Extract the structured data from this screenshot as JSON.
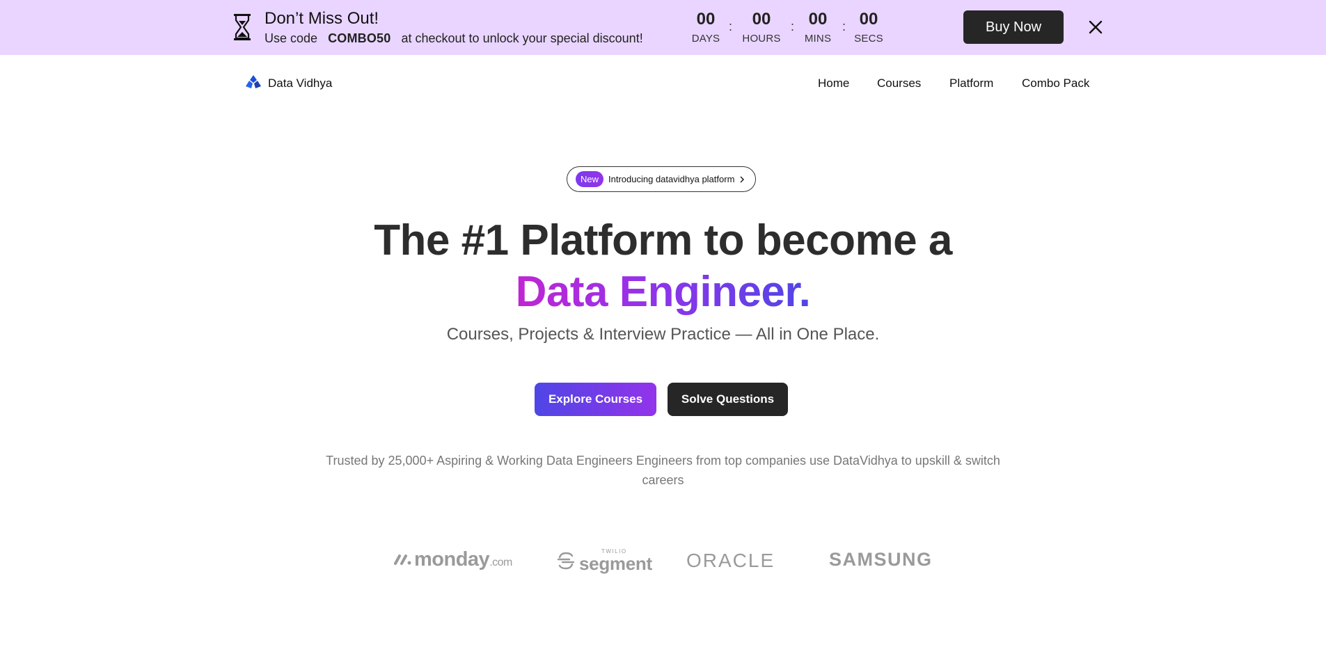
{
  "promo": {
    "title": "Don’t Miss Out!",
    "sub_before": "Use code",
    "code": "COMBO50",
    "sub_after": "at checkout to unlock your special discount!",
    "countdown": [
      {
        "value": "00",
        "unit": "DAYS"
      },
      {
        "value": "00",
        "unit": "HOURS"
      },
      {
        "value": "00",
        "unit": "MINS"
      },
      {
        "value": "00",
        "unit": "SECS"
      }
    ],
    "separator": ":",
    "buy_label": "Buy Now",
    "icons": {
      "timer": "hourglass-icon",
      "close": "close-icon"
    }
  },
  "nav": {
    "brand": "Data Vidhya",
    "links": [
      "Home",
      "Courses",
      "Platform",
      "Combo Pack"
    ]
  },
  "hero": {
    "pill_badge": "New",
    "pill_text": "Introducing datavidhya platform",
    "title_line1": "The #1 Platform to become a",
    "title_line2": "Data Engineer.",
    "subtitle": "Courses, Projects & Interview Practice — All in One Place.",
    "explore_label": "Explore Courses",
    "solve_label": "Solve Questions",
    "trusted": "Trusted by 25,000+ Aspiring & Working Data Engineers Engineers from top companies use DataVidhya to upskill & switch careers"
  },
  "companies": {
    "monday_main": "monday",
    "monday_suffix": ".com",
    "segment_small": "TWILIO",
    "segment_main": "segment",
    "oracle": "ORACLE",
    "samsung": "SAMSUNG"
  },
  "colors": {
    "banner_bg": "#e9d5ff",
    "accent_start": "#4f46e5",
    "accent_end": "#9333ea",
    "dark_button": "#262626"
  }
}
